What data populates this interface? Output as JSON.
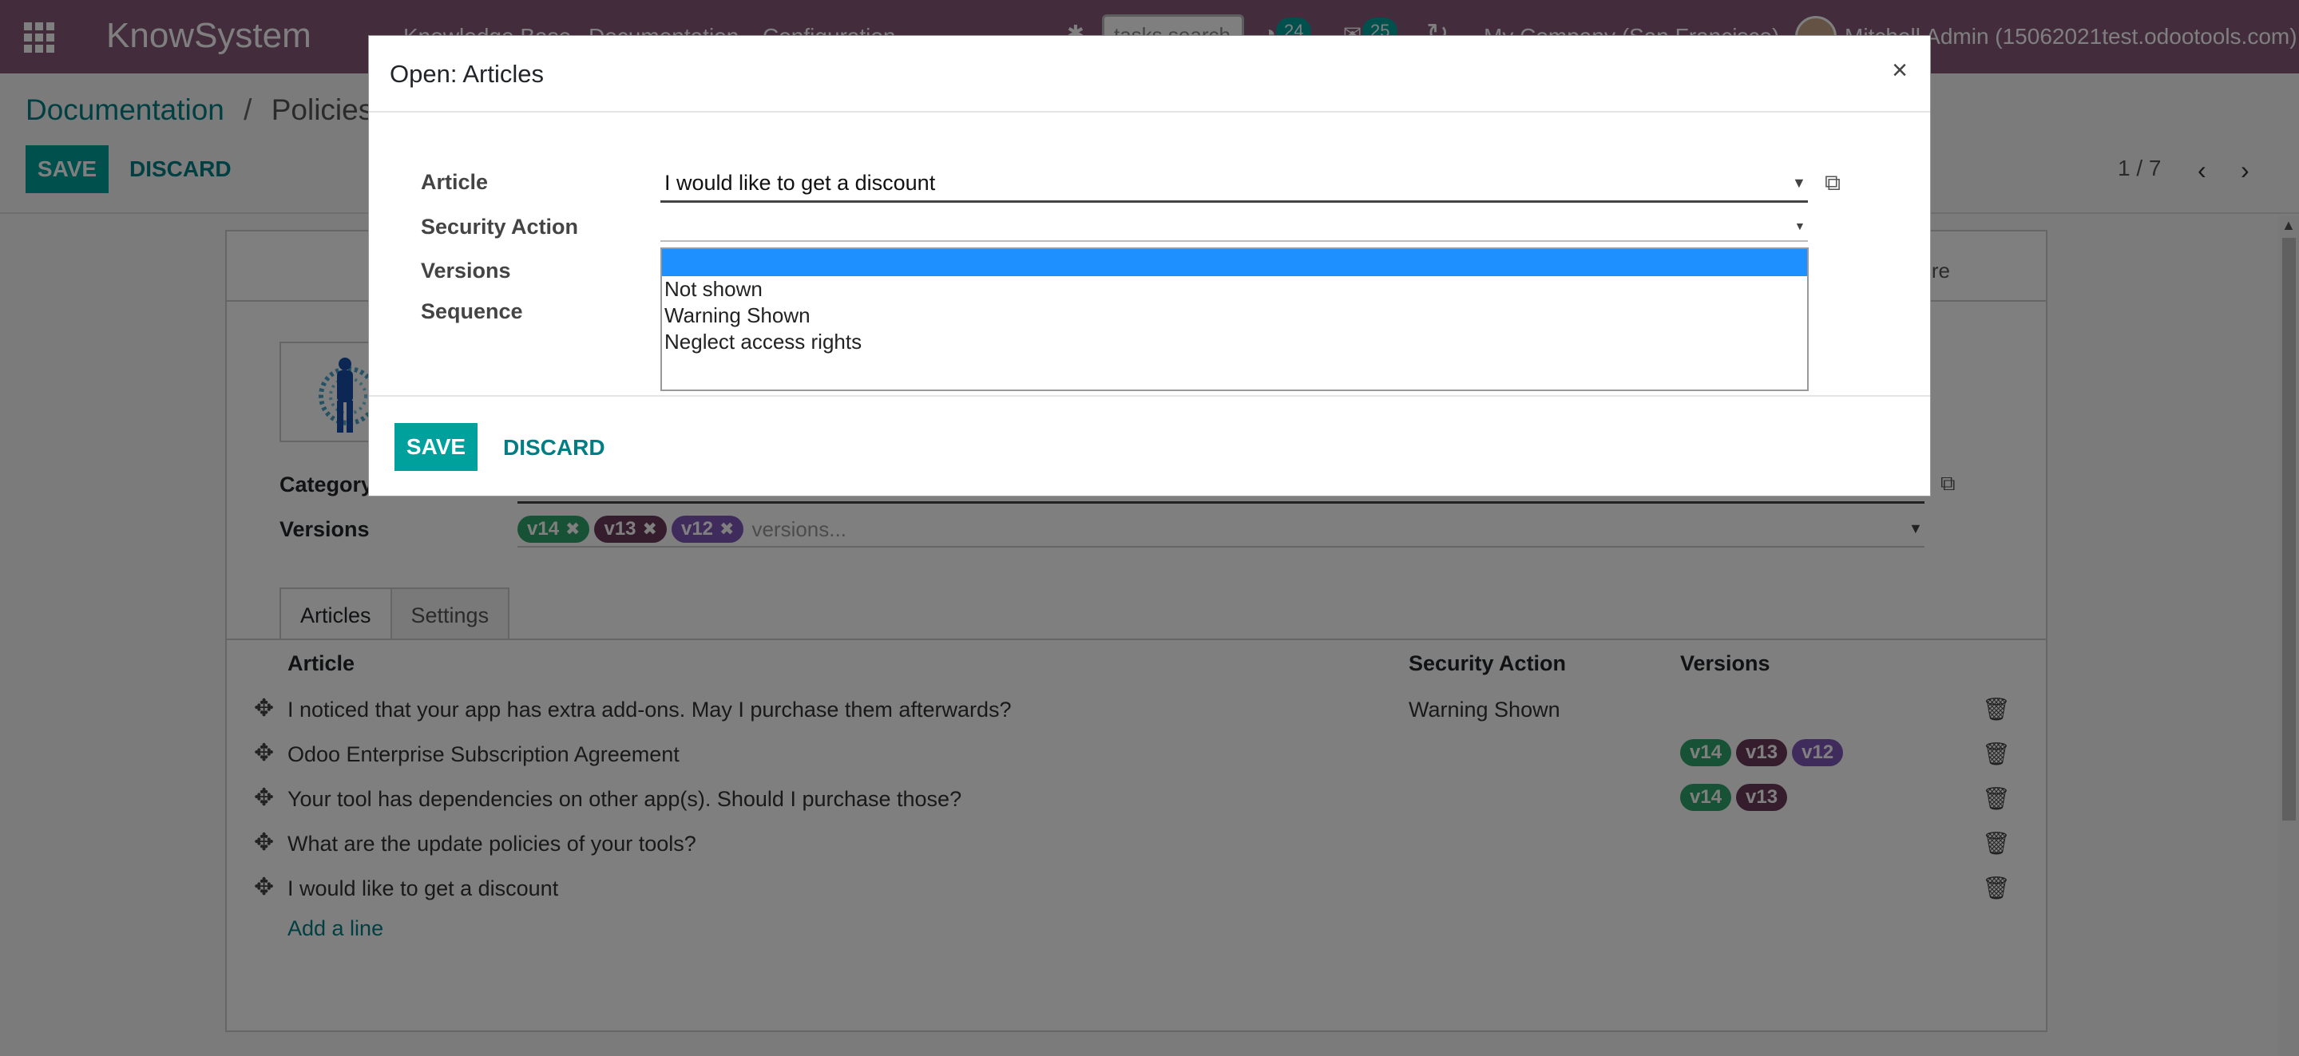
{
  "navbar": {
    "brand": "KnowSystem",
    "menu": [
      "Knowledge Base",
      "Documentation",
      "Configuration"
    ],
    "search_placeholder": "tasks search",
    "activity_count": "24",
    "message_count": "25",
    "company": "My Company (San Francisco)",
    "user": "Mitchell Admin (15062021test.odootools.com)"
  },
  "breadcrumb": {
    "parent": "Documentation",
    "separator": "/",
    "current": "Policies"
  },
  "control_panel": {
    "save": "SAVE",
    "discard": "DISCARD",
    "pager": "1 / 7"
  },
  "form": {
    "statusbar_text": "re",
    "category_label": "Category",
    "versions_label": "Versions",
    "versions_tags": [
      "v14",
      "v13",
      "v12"
    ],
    "versions_placeholder": "versions...",
    "tabs": [
      "Articles",
      "Settings"
    ],
    "columns": {
      "article": "Article",
      "security": "Security Action",
      "versions": "Versions"
    },
    "rows": [
      {
        "article": "I noticed that your app has extra add-ons. May I purchase them afterwards?",
        "security": "Warning Shown",
        "versions": []
      },
      {
        "article": "Odoo Enterprise Subscription Agreement",
        "security": "",
        "versions": [
          "v14",
          "v13",
          "v12"
        ]
      },
      {
        "article": "Your tool has dependencies on other app(s). Should I purchase those?",
        "security": "",
        "versions": [
          "v14",
          "v13"
        ]
      },
      {
        "article": "What are the update policies of your tools?",
        "security": "",
        "versions": []
      },
      {
        "article": "I would like to get a discount",
        "security": "",
        "versions": []
      }
    ],
    "add_line": "Add a line"
  },
  "modal": {
    "title": "Open: Articles",
    "close": "×",
    "article_label": "Article",
    "article_value": "I would like to get a discount",
    "security_label": "Security Action",
    "versions_label": "Versions",
    "sequence_label": "Sequence",
    "security_options": [
      "",
      "Not shown",
      "Warning Shown",
      "Neglect access rights"
    ],
    "save": "SAVE",
    "discard": "DISCARD"
  },
  "colors": {
    "navbar": "#875a7b",
    "primary": "#00a09d",
    "link": "#017e84",
    "v14": "#30a46c",
    "v13": "#6b3a5b",
    "v12": "#7f56b8",
    "highlight": "#1e90ff"
  },
  "icons": {
    "apps": "apps-grid-icon",
    "close": "close-icon",
    "external": "external-link-icon",
    "handle": "drag-handle-icon",
    "trash": "trash-icon",
    "caret": "caret-down-icon"
  }
}
